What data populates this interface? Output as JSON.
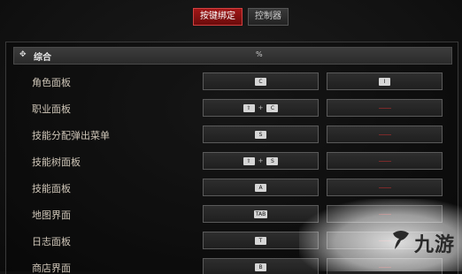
{
  "tabs": [
    {
      "label": "按键绑定",
      "active": true
    },
    {
      "label": "控制器",
      "active": false
    }
  ],
  "section": {
    "title": "综合",
    "header_mark": "%"
  },
  "rows": [
    {
      "label": "角色面板",
      "primary": [
        "C"
      ],
      "secondary": [
        "I"
      ]
    },
    {
      "label": "职业面板",
      "primary": [
        "⇧",
        "C"
      ],
      "secondary": []
    },
    {
      "label": "技能分配弹出菜单",
      "primary": [
        "S"
      ],
      "secondary": []
    },
    {
      "label": "技能树面板",
      "primary": [
        "⇧",
        "S"
      ],
      "secondary": []
    },
    {
      "label": "技能面板",
      "primary": [
        "A"
      ],
      "secondary": []
    },
    {
      "label": "地图界面",
      "primary": [
        "TAB"
      ],
      "secondary": []
    },
    {
      "label": "日志面板",
      "primary": [
        "T"
      ],
      "secondary": []
    },
    {
      "label": "商店界面",
      "primary": [
        "B"
      ],
      "secondary": []
    }
  ],
  "combo_separator": "+",
  "watermark": {
    "text": "九游"
  },
  "colors": {
    "active_tab": "#8c1212",
    "unbound_dash": "#7a2a2a"
  }
}
